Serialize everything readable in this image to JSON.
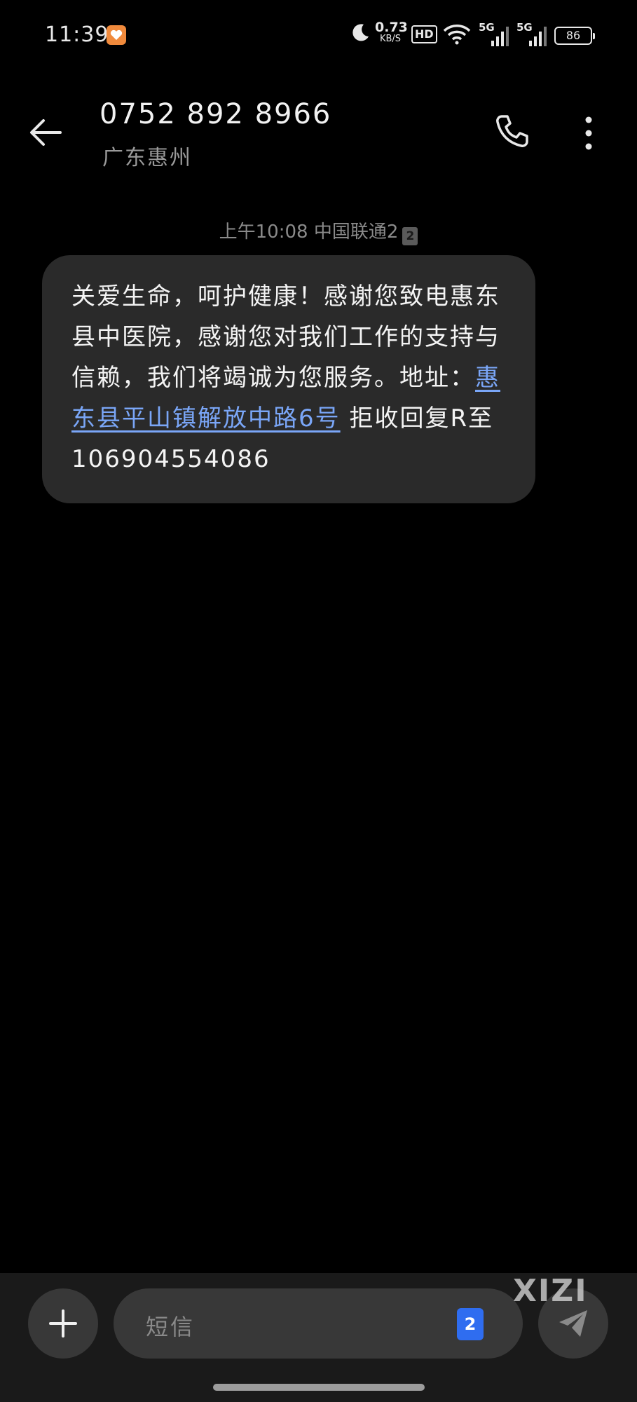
{
  "status_bar": {
    "time": "11:39",
    "net_speed_value": "0.73",
    "net_speed_unit": "KB/S",
    "hd_label": "HD",
    "sim1_label": "5G",
    "sim2_label": "5G",
    "battery": "86"
  },
  "header": {
    "contact_number": "0752 892 8966",
    "contact_location": "广东惠州"
  },
  "message": {
    "time": "上午10:08",
    "carrier": "中国联通2",
    "sim_badge": "2",
    "text_before_link": "关爱生命，呵护健康！感谢您致电惠东县中医院，感谢您对我们工作的支持与信赖，我们将竭诚为您服务。地址：",
    "link_text": "惠东县平山镇解放中路6号",
    "text_after_link": " 拒收回复R至106904554086"
  },
  "input_bar": {
    "placeholder": "短信",
    "sim_selector": "2",
    "watermark": "XIZI"
  },
  "colors": {
    "background": "#000000",
    "bubble": "#2a2a2a",
    "link": "#7aa6f7",
    "sim_badge": "#2f6df0"
  }
}
